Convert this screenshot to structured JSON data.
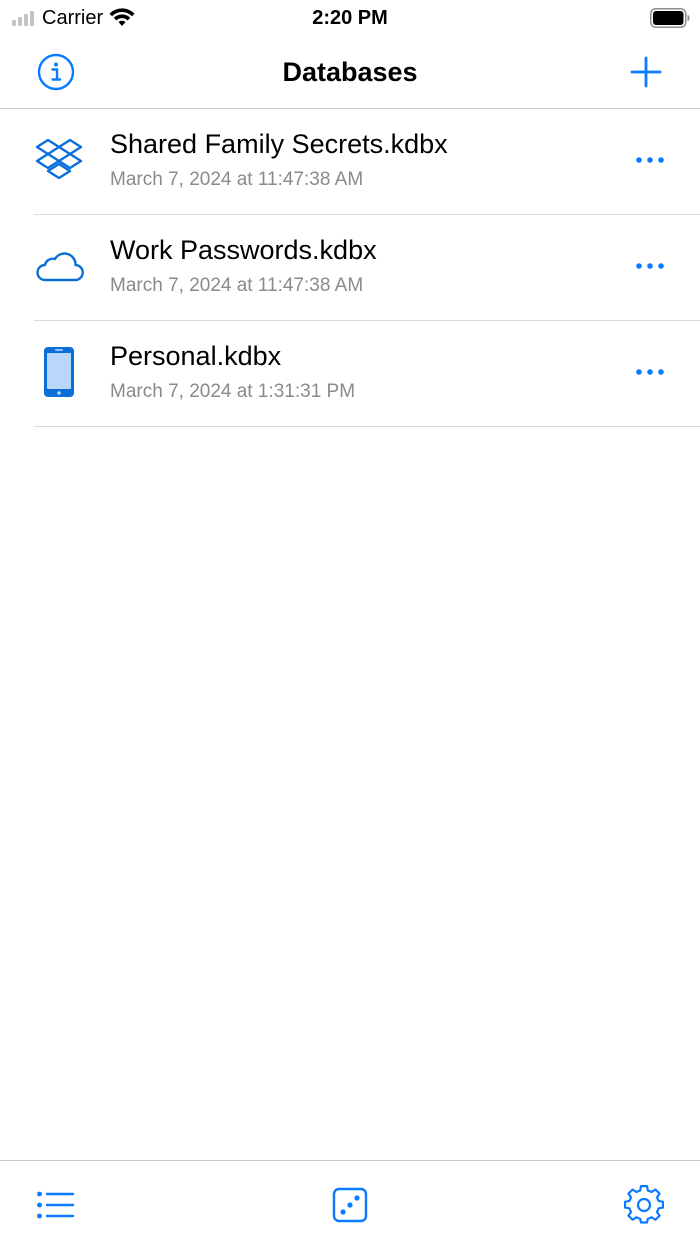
{
  "status_bar": {
    "carrier": "Carrier",
    "time": "2:20 PM"
  },
  "nav": {
    "title": "Databases",
    "info_icon": "info-icon",
    "add_icon": "plus-icon"
  },
  "databases": [
    {
      "name": "Shared Family Secrets.kdbx",
      "date": "March 7, 2024 at 11:47:38 AM",
      "icon": "dropbox-icon"
    },
    {
      "name": "Work Passwords.kdbx",
      "date": "March 7, 2024 at 11:47:38 AM",
      "icon": "cloud-icon"
    },
    {
      "name": "Personal.kdbx",
      "date": "March 7, 2024 at 1:31:31 PM",
      "icon": "iphone-icon"
    }
  ],
  "tab_bar": {
    "items": [
      "list-icon",
      "dice-icon",
      "gear-icon"
    ]
  },
  "colors": {
    "accent": "#0a7aff",
    "secondary_text": "#8a8a8e",
    "separator": "#d9d9dc"
  }
}
